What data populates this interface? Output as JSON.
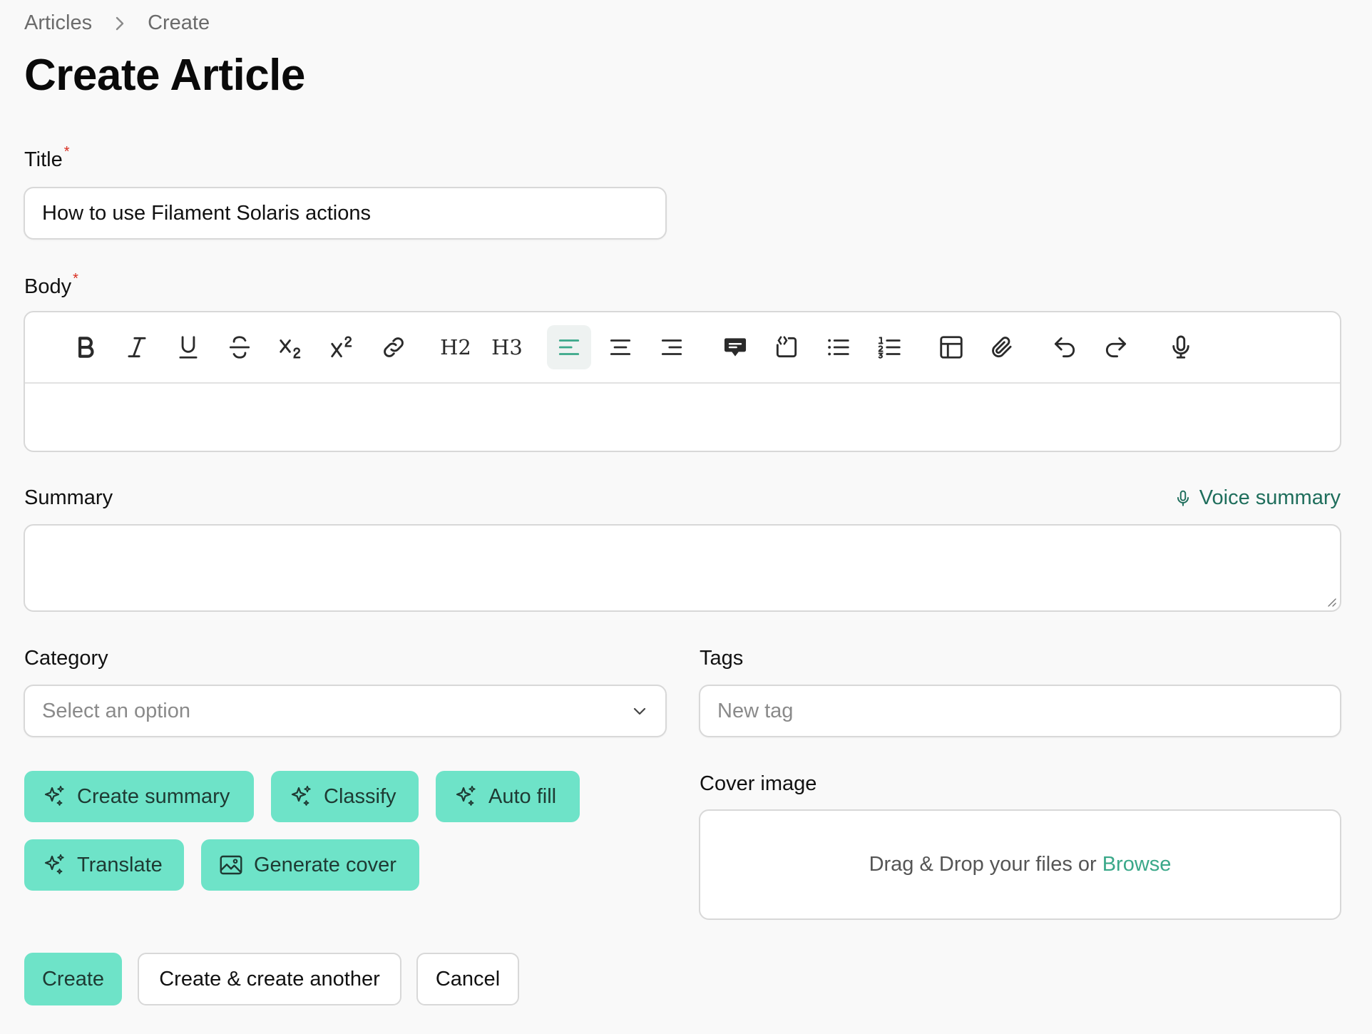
{
  "breadcrumb": {
    "parent": "Articles",
    "current": "Create"
  },
  "page": {
    "title": "Create Article"
  },
  "fields": {
    "title": {
      "label": "Title",
      "required_mark": "*",
      "value": "How to use Filament Solaris actions"
    },
    "body": {
      "label": "Body",
      "required_mark": "*"
    },
    "summary": {
      "label": "Summary",
      "voice_label": "Voice summary"
    },
    "category": {
      "label": "Category",
      "placeholder": "Select an option"
    },
    "tags": {
      "label": "Tags",
      "placeholder": "New tag"
    },
    "cover_image": {
      "label": "Cover image",
      "dropzone_text": "Drag & Drop your files or",
      "browse_label": "Browse"
    }
  },
  "toolbar": {
    "items": [
      "bold",
      "italic",
      "underline",
      "strike",
      "subscript",
      "superscript",
      "link",
      "h2",
      "h3",
      "align-start",
      "align-center",
      "align-end",
      "blockquote",
      "code-block",
      "bullet-list",
      "ordered-list",
      "table",
      "attach",
      "undo",
      "redo",
      "microphone"
    ],
    "active": "align-start",
    "h2_label": "H2",
    "h3_label": "H3"
  },
  "ai_actions": {
    "create_summary": "Create summary",
    "classify": "Classify",
    "auto_fill": "Auto fill",
    "translate": "Translate",
    "generate_cover": "Generate cover"
  },
  "form_actions": {
    "create": "Create",
    "create_another": "Create & create another",
    "cancel": "Cancel"
  },
  "colors": {
    "accent": "#6ee3c8",
    "accent_text": "#3aa889",
    "required": "#d92d20"
  }
}
